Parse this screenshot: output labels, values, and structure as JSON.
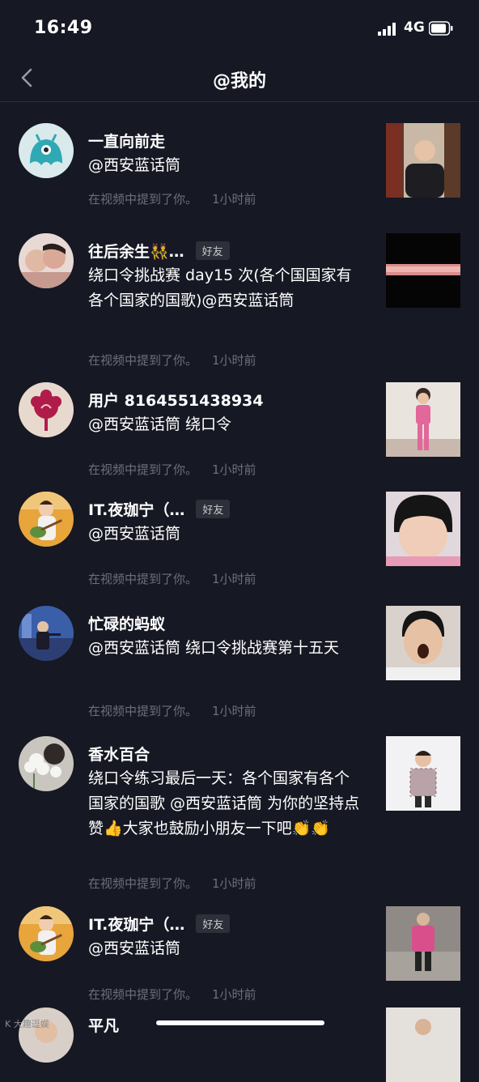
{
  "status_bar": {
    "time": "16:49",
    "network": "4G",
    "icons": [
      "signal-icon",
      "battery-icon"
    ]
  },
  "nav": {
    "back_icon": "chevron-left-icon",
    "title": "@我的"
  },
  "items": [
    {
      "name": "一直向前走",
      "badge": "",
      "content": "@西安蓝话筒",
      "meta_text": "在视频中提到了你。",
      "time": "1小时前"
    },
    {
      "name": "往后余生👯…",
      "badge": "好友",
      "content": "绕口令挑战赛 day15 次(各个国国家有各个国家的国歌)@西安蓝话筒",
      "meta_text": "在视频中提到了你。",
      "time": "1小时前"
    },
    {
      "name": "用户 8164551438934",
      "badge": "",
      "content": "@西安蓝话筒 绕口令",
      "meta_text": "在视频中提到了你。",
      "time": "1小时前"
    },
    {
      "name": "IT.夜珈宁（…",
      "badge": "好友",
      "content": "@西安蓝话筒",
      "meta_text": "在视频中提到了你。",
      "time": "1小时前"
    },
    {
      "name": "忙碌的蚂蚁",
      "badge": "",
      "content": "@西安蓝话筒 绕口令挑战赛第十五天",
      "meta_text": "在视频中提到了你。",
      "time": "1小时前"
    },
    {
      "name": "香水百合",
      "badge": "",
      "content": "绕口令练习最后一天：各个国家有各个国家的国歌 @西安蓝话筒 为你的坚持点赞👍大家也鼓励小朋友一下吧👏👏",
      "meta_text": "在视频中提到了你。",
      "time": "1小时前"
    },
    {
      "name": "IT.夜珈宁（…",
      "badge": "好友",
      "content": "@西安蓝话筒",
      "meta_text": "在视频中提到了你。",
      "time": "1小时前"
    },
    {
      "name": "平凡",
      "badge": "",
      "content": "",
      "meta_text": "",
      "time": ""
    }
  ],
  "watermark": "K 大趣逗娱",
  "colors": {
    "background": "#161823",
    "text": "#ffffff",
    "meta": "#6d6f78",
    "badge_bg": "#2d2f39"
  }
}
